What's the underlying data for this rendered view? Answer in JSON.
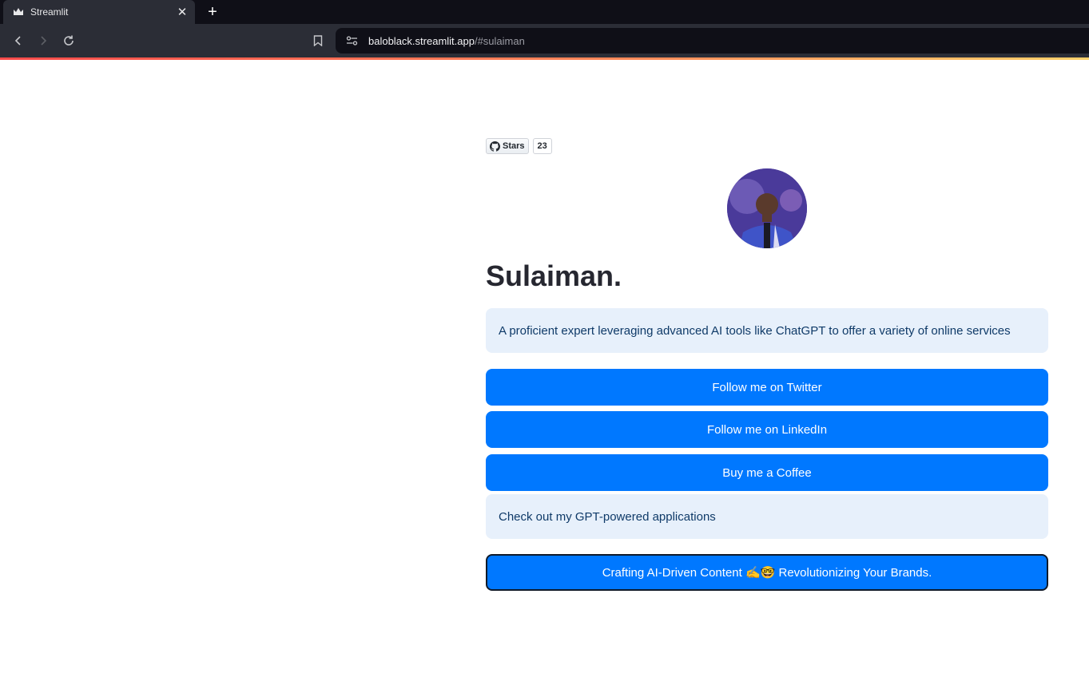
{
  "browser": {
    "tab_title": "Streamlit",
    "close_glyph": "✕",
    "new_tab_glyph": "+",
    "url_host": "baloblack.streamlit.app",
    "url_path": "/#sulaiman"
  },
  "github": {
    "stars_label": "Stars",
    "stars_count": "23"
  },
  "profile": {
    "name": "Sulaiman.",
    "bio": "A proficient expert leveraging advanced AI tools like ChatGPT to offer a variety of online services"
  },
  "links": {
    "twitter": "Follow me on Twitter",
    "linkedin": "Follow me on LinkedIn",
    "coffee": "Buy me a Coffee"
  },
  "apps_info": "Check out my GPT-powered applications",
  "cta": "Crafting AI-Driven Content ✍️🤓 Revolutionizing Your Brands.",
  "colors": {
    "primary_button": "#0078ff",
    "info_background": "#e7f0fb",
    "info_text": "#0f3a68",
    "heading": "#262730"
  }
}
